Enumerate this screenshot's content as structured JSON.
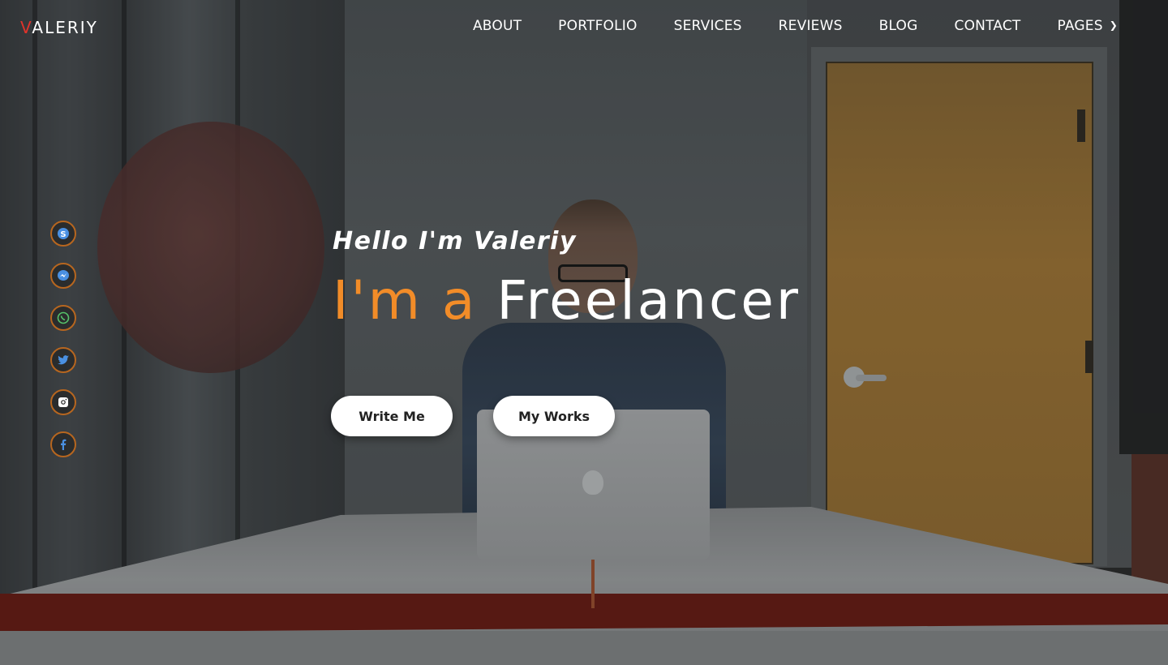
{
  "brand": {
    "logo_first": "V",
    "logo_rest": "ALERIY"
  },
  "nav": {
    "items": [
      "ABOUT",
      "PORTFOLIO",
      "SERVICES",
      "REVIEWS",
      "BLOG",
      "CONTACT",
      "PAGES"
    ]
  },
  "hero": {
    "greeting": "Hello I'm Valeriy",
    "headline_accent": "I'm a",
    "headline_word": "Freelancer",
    "primary_button": "Write Me",
    "secondary_button": "My Works"
  },
  "social": [
    {
      "name": "skype",
      "icon": "skype-icon"
    },
    {
      "name": "messenger",
      "icon": "messenger-icon"
    },
    {
      "name": "whatsapp",
      "icon": "whatsapp-icon"
    },
    {
      "name": "twitter",
      "icon": "twitter-icon"
    },
    {
      "name": "instagram",
      "icon": "instagram-icon"
    },
    {
      "name": "facebook",
      "icon": "facebook-icon"
    }
  ],
  "colors": {
    "accent": "#f28c28",
    "logo_red": "#e0332b",
    "social_ring": "#b7661f",
    "social_icon": "#4a90e2"
  }
}
